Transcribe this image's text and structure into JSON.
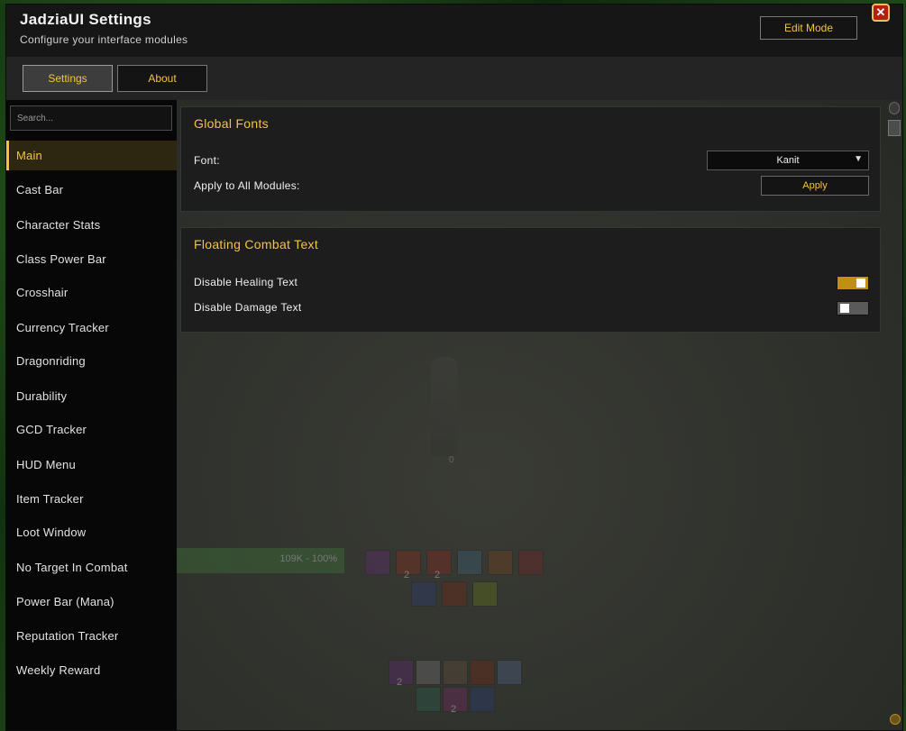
{
  "window": {
    "title": "JadziaUI Settings",
    "subtitle": "Configure your interface modules",
    "edit_mode_label": "Edit Mode",
    "close_glyph": "✕"
  },
  "tabs": [
    {
      "label": "Settings",
      "active": true
    },
    {
      "label": "About",
      "active": false
    }
  ],
  "search": {
    "placeholder": "Search...",
    "value": ""
  },
  "sidebar": {
    "items": [
      {
        "label": "Main",
        "active": true
      },
      {
        "label": "Cast Bar"
      },
      {
        "label": "Character Stats"
      },
      {
        "label": "Class Power Bar"
      },
      {
        "label": "Crosshair"
      },
      {
        "label": "Currency Tracker"
      },
      {
        "label": "Dragonriding"
      },
      {
        "label": "Durability"
      },
      {
        "label": "GCD Tracker"
      },
      {
        "label": "HUD Menu"
      },
      {
        "label": "Item Tracker"
      },
      {
        "label": "Loot Window"
      },
      {
        "label": "No Target In Combat"
      },
      {
        "label": "Power Bar (Mana)"
      },
      {
        "label": "Reputation Tracker"
      },
      {
        "label": "Weekly Reward"
      }
    ]
  },
  "global_fonts": {
    "title": "Global Fonts",
    "font_label": "Font:",
    "font_value": "Kanit",
    "dropdown_caret": "▼",
    "apply_all_label": "Apply to All Modules:",
    "apply_button": "Apply"
  },
  "floating_combat_text": {
    "title": "Floating Combat Text",
    "disable_healing_label": "Disable Healing Text",
    "disable_healing_on": true,
    "disable_damage_label": "Disable Damage Text",
    "disable_damage_on": false
  },
  "hud_background": {
    "health_text": "109K - 100%",
    "target_number": "0",
    "icon_counts": [
      "2",
      "2",
      "2",
      "2"
    ]
  },
  "colors": {
    "accent": "#f3c43b",
    "toggle_on": "#c08f14",
    "close": "#b3200f"
  }
}
